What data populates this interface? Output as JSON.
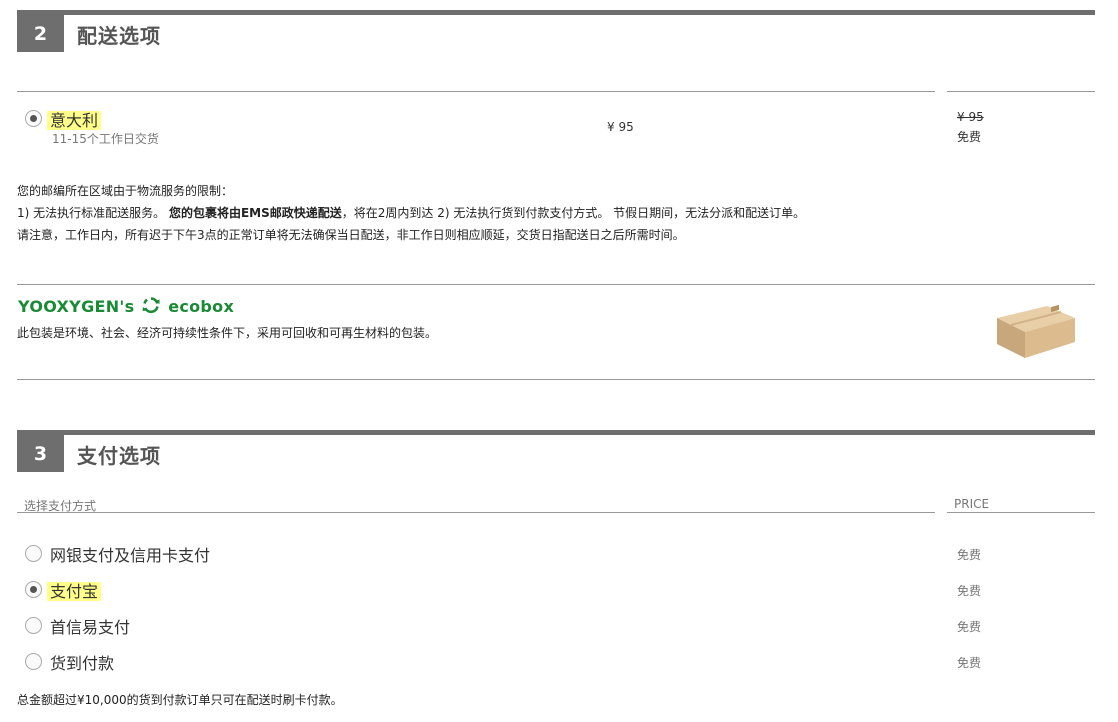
{
  "shipping": {
    "step": "2",
    "title": "配送选项",
    "option": {
      "name": "意大利",
      "eta": "11-15个工作日交货",
      "price": "¥ 95",
      "old_price": "¥ 95",
      "final_price": "免费",
      "selected": true
    },
    "notice": {
      "line1": "您的邮编所在区域由于物流服务的限制：",
      "line2_a": "1) 无法执行标准配送服务。 ",
      "line2_bold": "您的包裹将由EMS邮政快递配送",
      "line2_b": "，将在2周内到达 2) 无法执行货到付款支付方式。 节假日期间，无法分派和配送订单。",
      "line3": "请注意，工作日内，所有迟于下午3点的正常订单将无法确保当日配送，非工作日则相应顺延，交货日指配送日之后所需时间。"
    },
    "ecobox": {
      "brand_a": "YOOXYGEN's",
      "brand_b": "ecobox",
      "desc": "此包装是环境、社会、经济可持续性条件下，采用可回收和可再生材料的包装。"
    }
  },
  "payment": {
    "step": "3",
    "title": "支付选项",
    "col_method": "选择支付方式",
    "col_price": "PRICE",
    "options": [
      {
        "label": "网银支付及信用卡支付",
        "price": "免费",
        "selected": false
      },
      {
        "label": "支付宝",
        "price": "免费",
        "selected": true
      },
      {
        "label": "首信易支付",
        "price": "免费",
        "selected": false
      },
      {
        "label": "货到付款",
        "price": "免费",
        "selected": false
      }
    ],
    "footnote": "总金额超过¥10,000的货到付款订单只可在配送时刷卡付款。"
  },
  "colors": {
    "header": "#6e6e6e",
    "highlight": "#ffff8a",
    "eco_green": "#1a8a35"
  }
}
